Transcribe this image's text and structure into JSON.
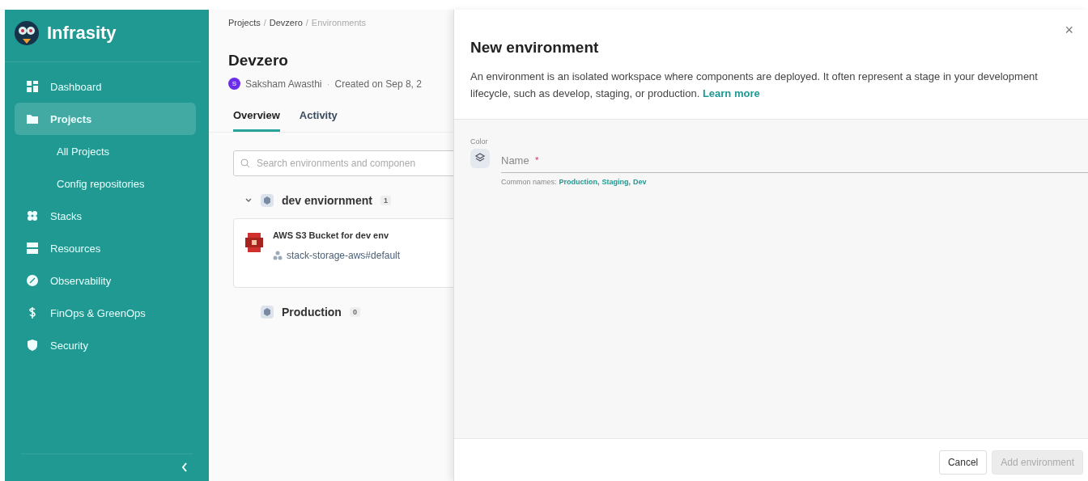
{
  "sidebar": {
    "brand": "Infrasity",
    "items": [
      {
        "label": "Dashboard",
        "selected": false
      },
      {
        "label": "Projects",
        "selected": true,
        "children": [
          {
            "label": "All Projects"
          },
          {
            "label": "Config repositories"
          }
        ]
      },
      {
        "label": "Stacks",
        "selected": false
      },
      {
        "label": "Resources",
        "selected": false
      },
      {
        "label": "Observability",
        "selected": false
      },
      {
        "label": "FinOps & GreenOps",
        "selected": false
      },
      {
        "label": "Security",
        "selected": false
      }
    ]
  },
  "breadcrumbs": [
    {
      "kind": "link",
      "label": "Projects",
      "current": false
    },
    {
      "kind": "separator",
      "label": "/"
    },
    {
      "kind": "link",
      "label": "Devzero",
      "current": false
    },
    {
      "kind": "separator",
      "label": "/"
    },
    {
      "kind": "link",
      "label": "Environments",
      "current": true
    }
  ],
  "project": {
    "title": "Devzero",
    "owner": "Saksham Awasthi",
    "owner_initial": "S",
    "separator": "·",
    "created": "Created on Sep 8, 2"
  },
  "tabs": [
    {
      "label": "Overview",
      "selected": true
    },
    {
      "label": "Activity",
      "selected": false
    }
  ],
  "search": {
    "placeholder": "Search environments and componen"
  },
  "environments": [
    {
      "name": "dev enviornment",
      "count": "1",
      "components": [
        {
          "title": "AWS S3 Bucket for dev env",
          "stack": "stack-storage-aws#default"
        }
      ]
    },
    {
      "name": "Production",
      "count": "0"
    }
  ],
  "dialog": {
    "title": "New environment",
    "description": "An environment is an isolated workspace where components are deployed. It often represent a stage in your development lifecycle, such as develop, staging, or production.",
    "link": "Learn more",
    "close": "×",
    "color_label": "Color",
    "name_field": {
      "placeholder": "Name",
      "required_mark": "*"
    },
    "hint_label": "Common names:",
    "suggestions": [
      "Production,",
      "Staging,",
      "Dev"
    ],
    "buttons": [
      {
        "label": "Cancel",
        "disabled": false
      },
      {
        "label": "Add environment",
        "disabled": true
      }
    ]
  }
}
